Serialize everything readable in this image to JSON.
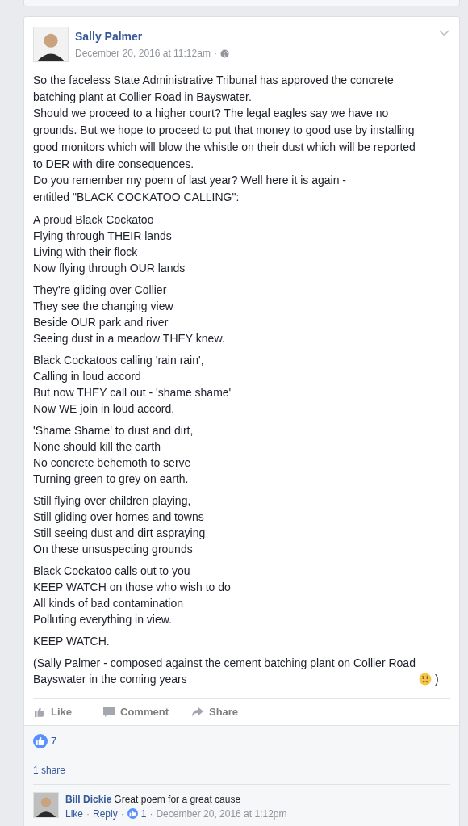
{
  "post": {
    "author": "Sally Palmer",
    "timestamp": "December 20, 2016 at 11:12am",
    "separator": "·",
    "paragraphs": [
      "So the faceless State Administrative Tribunal has approved the concrete\nbatching plant at Collier Road in Bayswater.\nShould we proceed to a higher court? The legal eagles say we have no\ngrounds. But we hope to proceed to put that money to good use by installing\ngood monitors which will blow the whistle on their dust which will be reported\nto DER with dire consequences.\nDo you remember my poem of last year? Well here it is again -\nentitled \"BLACK COCKATOO CALLING\":",
      "A proud Black Cockatoo\nFlying through THEIR lands\nLiving with their flock\nNow flying through OUR lands",
      "They're gliding over Collier\nThey see the changing view\nBeside OUR park and river\nSeeing dust in a meadow THEY knew.",
      "Black Cockatoos calling 'rain rain',\nCalling in loud accord\nBut now THEY call out - 'shame shame'\nNow WE join in loud accord.",
      "'Shame Shame' to dust and dirt,\nNone should kill the earth\nNo concrete behemoth to serve\nTurning green to grey on earth.",
      "Still flying over children playing,\nStill gliding over homes and towns\nStill seeing dust and dirt aspraying\nOn these unsuspecting grounds",
      "Black Cockatoo calls out to you\nKEEP WATCH on those who wish to do\nAll kinds of bad contamination\nPolluting everything in view.",
      "KEEP WATCH."
    ],
    "closing": {
      "text": "(Sally Palmer - composed against the cement batching plant on Collier Road\nBayswater in the coming years",
      "after": ")"
    },
    "actions": [
      "Like",
      "Comment",
      "Share"
    ],
    "like_count": "7",
    "shares": "1 share",
    "comment": {
      "author": "Bill Dickie",
      "text": "Great poem for a great cause",
      "links": [
        "Like",
        "Reply"
      ],
      "likes": "1",
      "timestamp": "December 20, 2016 at 1:12pm",
      "separator": "·"
    }
  }
}
